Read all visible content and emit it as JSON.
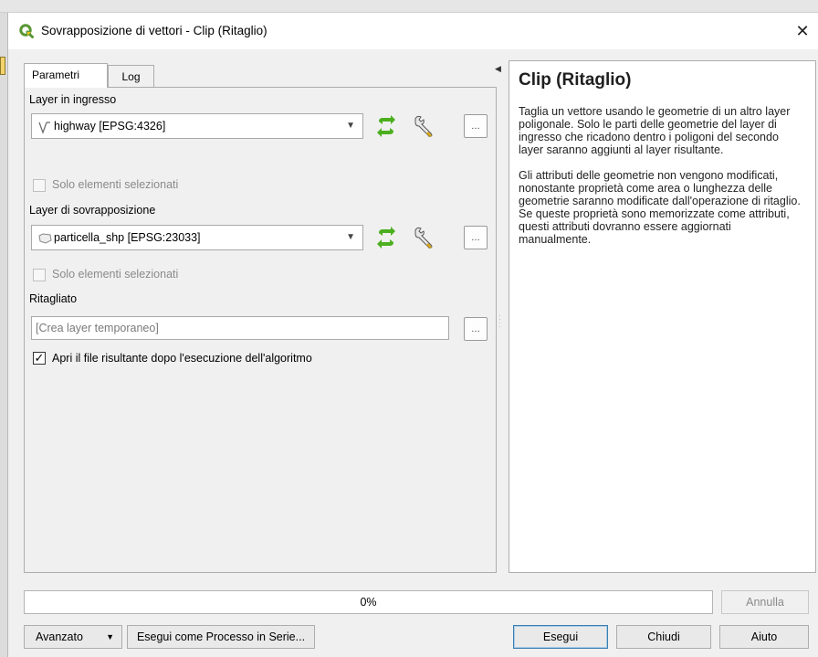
{
  "window": {
    "title": "Sovrapposizione di vettori - Clip (Ritaglio)",
    "close_symbol": "✕"
  },
  "tabs": [
    {
      "label": "Parametri",
      "active": true
    },
    {
      "label": "Log",
      "active": false
    }
  ],
  "params": {
    "input_layer_label": "Layer in ingresso",
    "input_layer_value": "highway [EPSG:4326]",
    "input_selected_only": "Solo elementi selezionati",
    "overlay_layer_label": "Layer di sovrapposizione",
    "overlay_layer_value": "particella_shp [EPSG:23033]",
    "overlay_selected_only": "Solo elementi selezionati",
    "output_label": "Ritagliato",
    "output_placeholder": "[Crea layer temporaneo]",
    "open_output_label": "Apri il file risultante dopo l'esecuzione dell'algoritmo",
    "open_output_checked": true,
    "dots": "…"
  },
  "help": {
    "title": "Clip (Ritaglio)",
    "paragraphs": [
      "Taglia un vettore usando le geometrie di un altro layer poligonale. Solo le parti delle geometrie del layer di ingresso che ricadono dentro i poligoni del secondo layer saranno aggiunti al layer risultante.",
      "Gli attributi delle geometrie non vengono modificati, nonostante proprietà come area o lunghezza delle geometrie saranno modificate dall'operazione di ritaglio. Se queste proprietà sono memorizzate come attributi, questi attributi dovranno essere aggiornati manualmente."
    ]
  },
  "progress": {
    "text": "0%",
    "value": 0
  },
  "buttons": {
    "cancel": "Annulla",
    "advanced": "Avanzato",
    "batch": "Esegui come Processo in Serie...",
    "run": "Esegui",
    "close": "Chiudi",
    "help": "Aiuto"
  },
  "colors": {
    "qgis_green": "#589632",
    "refresh_green": "#4caf1f",
    "default_button_border": "#3c7fb1"
  },
  "icons": {
    "line_layer": "line-layer-icon",
    "polygon_layer": "polygon-layer-icon",
    "iterate": "iterate-icon",
    "settings": "wrench-icon"
  }
}
